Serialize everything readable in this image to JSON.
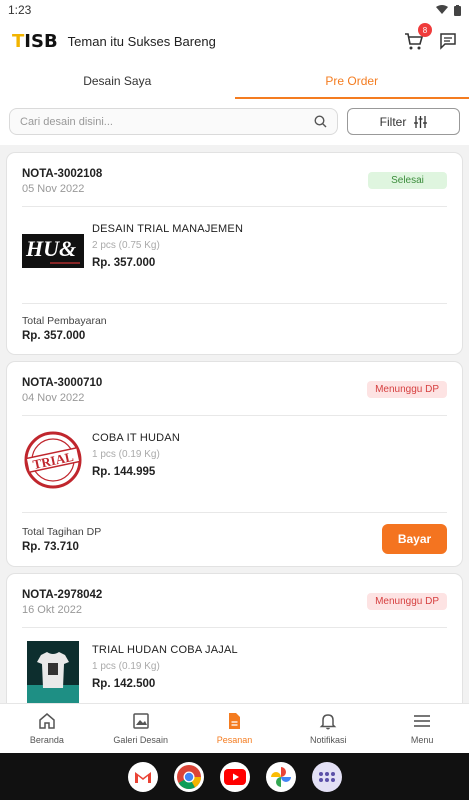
{
  "status_bar": {
    "time": "1:23"
  },
  "header": {
    "logo_letters": [
      "T",
      "ISB"
    ],
    "title": "Teman itu Sukses Bareng",
    "cart_count": "8"
  },
  "tabs": [
    {
      "label": "Desain Saya",
      "active": false
    },
    {
      "label": "Pre Order",
      "active": true
    }
  ],
  "search": {
    "placeholder": "Cari desain disini...",
    "filter_label": "Filter"
  },
  "orders": [
    {
      "nota": "NOTA-3002108",
      "date": "05 Nov 2022",
      "status": "Selesai",
      "item_name": "DESAIN TRIAL MANAJEMEN",
      "item_meta": "2 pcs (0.75 Kg)",
      "item_price": "Rp. 357.000",
      "thumb_text": "HU&",
      "footer_label": "Total Pembayaran",
      "footer_amount": "Rp. 357.000"
    },
    {
      "nota": "NOTA-3000710",
      "date": "04 Nov 2022",
      "status": "Menunggu DP",
      "item_name": "COBA IT HUDAN",
      "item_meta": "1 pcs (0.19 Kg)",
      "item_price": "Rp. 144.995",
      "thumb_text": "TRIAL",
      "footer_label": "Total Tagihan DP",
      "footer_amount": "Rp. 73.710",
      "pay_label": "Bayar"
    },
    {
      "nota": "NOTA-2978042",
      "date": "16 Okt 2022",
      "status": "Menunggu DP",
      "item_name": "TRIAL HUDAN COBA JAJAL",
      "item_meta": "1 pcs (0.19 Kg)",
      "item_price": "Rp. 142.500"
    }
  ],
  "bottom_nav": [
    {
      "label": "Beranda",
      "icon": "home-icon"
    },
    {
      "label": "Galeri Desain",
      "icon": "gallery-icon"
    },
    {
      "label": "Pesanan",
      "icon": "orders-icon",
      "active": true
    },
    {
      "label": "Notifikasi",
      "icon": "bell-icon"
    },
    {
      "label": "Menu",
      "icon": "menu-icon"
    }
  ],
  "dock": [
    "gmail-icon",
    "chrome-icon",
    "youtube-icon",
    "photos-icon",
    "apps-icon"
  ],
  "colors": {
    "accent": "#f47420",
    "done_bg": "#dff5df",
    "wait_bg": "#fde3e3"
  }
}
